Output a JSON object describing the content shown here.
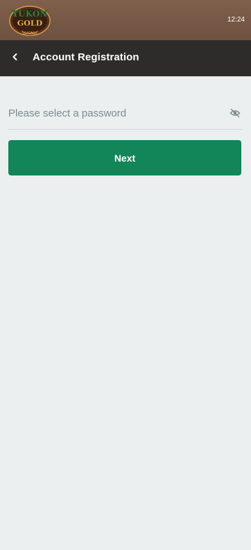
{
  "status_bar": {
    "time": "12:24",
    "background_color": "#7a5a46"
  },
  "logo": {
    "brand_line1": "YUKON",
    "brand_line2": "GOLD",
    "brand_line3": "CASINO"
  },
  "header": {
    "title": "Account Registration",
    "back_icon": "chevron-left-icon",
    "background_color": "#2e2c2b"
  },
  "form": {
    "password_placeholder": "Please select a password",
    "password_value": "",
    "visibility_icon": "eye-off-icon"
  },
  "actions": {
    "next_label": "Next",
    "next_color": "#128559"
  },
  "page": {
    "background_color": "#ebeff0"
  }
}
